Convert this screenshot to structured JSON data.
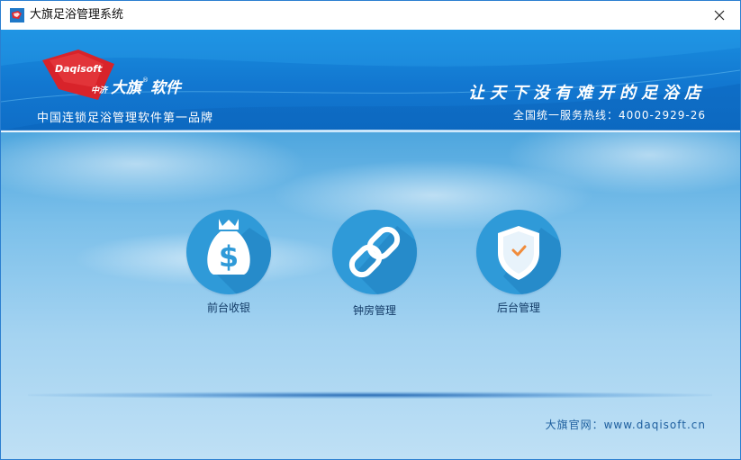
{
  "window": {
    "title": "大旗足浴管理系统",
    "close_icon": "close-icon",
    "app_icon": "app-logo-icon"
  },
  "header": {
    "logo_text_en": "Daqisoft",
    "logo_text_prefix": "中济",
    "logo_text_cn": "大旗",
    "logo_text_suffix": "软件",
    "logo_registered": "®",
    "slogan": "中国连锁足浴管理软件第一品牌",
    "tagline": "让天下没有难开的足浴店",
    "hotline": "全国统一服务热线：4000-2929-26",
    "colors": {
      "banner": "#1277d0",
      "logo_flag": "#d8232a"
    }
  },
  "modules": [
    {
      "label": "前台收银",
      "icon": "money-bag-dollar-icon"
    },
    {
      "label": "钟房管理",
      "icon": "chain-link-icon"
    },
    {
      "label": "后台管理",
      "icon": "shield-check-icon"
    }
  ],
  "footer": {
    "website": "大旗官网：www.daqisoft.cn"
  },
  "colors": {
    "tile_circle": "#2f9ad8",
    "sky_top": "#4ea6de",
    "sky_bottom": "#bfe0f5",
    "check_accent": "#f08c3c"
  }
}
